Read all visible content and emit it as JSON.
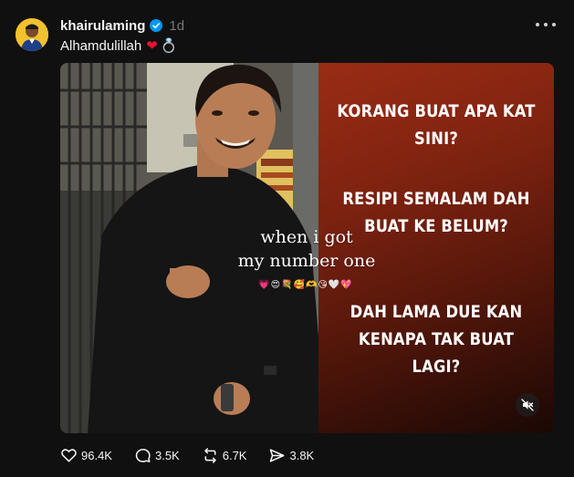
{
  "post": {
    "username": "khairulaming",
    "time": "1d",
    "caption": "Alhamdulillah",
    "caption_emoji_heart": "❤",
    "caption_emoji_ring": "💍"
  },
  "media": {
    "overlay_line1": "when i got",
    "overlay_line2": "my number one",
    "overlay_emojis": "💗😍💐🥰🫶😘🤍💖",
    "panel_q1_line1": "KORANG BUAT APA KAT",
    "panel_q1_line2": "SINI?",
    "panel_q2_line1": "RESIPI SEMALAM DAH",
    "panel_q2_line2": "BUAT KE BELUM?",
    "panel_q3_line1": "DAH LAMA DUE KAN",
    "panel_q3_line2": "KENAPA TAK BUAT LAGI?"
  },
  "actions": {
    "likes": "96.4K",
    "comments": "3.5K",
    "reposts": "6.7K",
    "shares": "3.8K"
  },
  "colors": {
    "background": "#101010",
    "verified": "#0095f6",
    "heart": "#e8132f",
    "panel_accent": "#9a2c14"
  },
  "icons": [
    "verified-badge-icon",
    "more-icon",
    "mute-icon",
    "heart-icon",
    "comment-icon",
    "repost-icon",
    "share-icon"
  ]
}
